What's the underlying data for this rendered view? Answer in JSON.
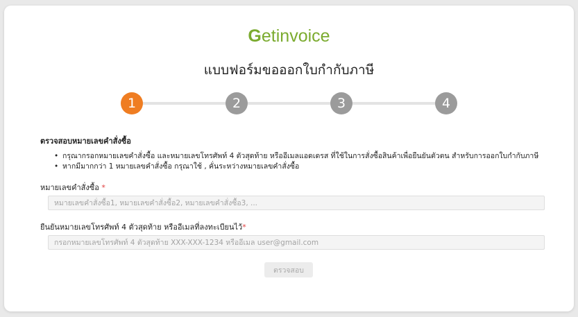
{
  "brand": {
    "logo_g": "G",
    "logo_rest_1": "et",
    "logo_rest_2": "invoice",
    "color": "#7bab2f"
  },
  "page_title": "แบบฟอร์มขอออกใบกำกับภาษี",
  "steps": [
    {
      "label": "1",
      "active": true
    },
    {
      "label": "2",
      "active": false
    },
    {
      "label": "3",
      "active": false
    },
    {
      "label": "4",
      "active": false
    }
  ],
  "section": {
    "title": "ตรวจสอบหมายเลขคำสั่งซื้อ",
    "bullets": [
      "กรุณากรอกหมายเลขคำสั่งซื้อ และหมายเลขโทรศัพท์ 4 ตัวสุดท้าย หรืออีเมลแอดเดรส ที่ใช้ในการสั่งซื้อสินค้าเพื่อยืนยันตัวตน สำหรับการออกใบกำกับภาษี",
      "หากมีมากกว่า 1 หมายเลขคำสั่งซื้อ กรุณาใช้ , คั่นระหว่างหมายเลขคำสั่งซื้อ"
    ]
  },
  "order_field": {
    "label": "หมายเลขคำสั่งซื้อ",
    "required_mark": "*",
    "value": "",
    "placeholder": "หมายเลขคำสั่งซื้อ1, หมายเลขคำสั่งซื้อ2, หมายเลขคำสั่งซื้อ3, ..."
  },
  "contact_field": {
    "label": "ยืนยันหมายเลขโทรศัพท์ 4 ตัวสุดท้าย หรืออีเมลที่ลงทะเบียนไว้",
    "required_mark": "*",
    "value": "",
    "placeholder": "กรอกหมายเลขโทรศัพท์ 4 ตัวสุดท้าย XXX-XXX-1234 หรืออีเมล user@gmail.com"
  },
  "submit_button": {
    "label": "ตรวจสอบ",
    "enabled": false
  },
  "colors": {
    "active_step": "#ef7d22",
    "inactive_step": "#9b9b9b",
    "required": "#e03c3c"
  }
}
